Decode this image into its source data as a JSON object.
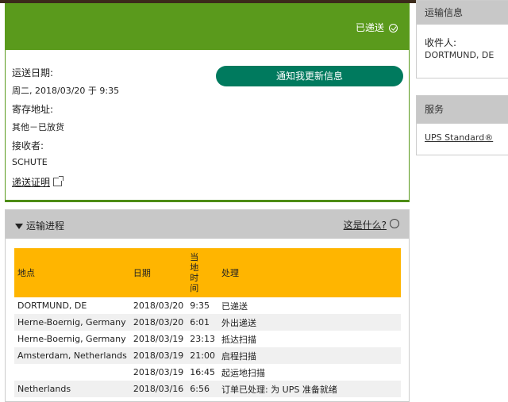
{
  "status": {
    "label": "已递送"
  },
  "delivery": {
    "date_label": "运送日期:",
    "date_value": "周二, 2018/03/20 于 9:35",
    "left_at_label": "寄存地址:",
    "left_at_value": "其他－已放货",
    "received_by_label": "接收者:",
    "received_by_value": "SCHUTE",
    "proof_link": "递送证明",
    "notify_button": "通知我更新信息"
  },
  "shipment_info": {
    "title": "运输信息",
    "recipient_label": "收件人:",
    "recipient_value": "DORTMUND, DE"
  },
  "service": {
    "title": "服务",
    "name": "UPS Standard®"
  },
  "progress": {
    "title": "运输进程",
    "whats_this": "这是什么?",
    "columns": {
      "location": "地点",
      "date": "日期",
      "local_time": "当\n地\n时\n间",
      "activity": "处理"
    },
    "rows": [
      {
        "location": "DORTMUND, DE",
        "date": "2018/03/20",
        "time": "9:35",
        "activity": "已递送"
      },
      {
        "location": "Herne-Boernig, Germany",
        "date": "2018/03/20",
        "time": "6:01",
        "activity": "外出递送"
      },
      {
        "location": "Herne-Boernig, Germany",
        "date": "2018/03/19",
        "time": "23:13",
        "activity": "抵达扫描"
      },
      {
        "location": "Amsterdam, Netherlands",
        "date": "2018/03/19",
        "time": "21:00",
        "activity": "启程扫描"
      },
      {
        "location": "",
        "date": "2018/03/19",
        "time": "16:45",
        "activity": "起运地扫描"
      },
      {
        "location": "Netherlands",
        "date": "2018/03/16",
        "time": "6:56",
        "activity": "订单已处理: 为 UPS 准备就绪"
      }
    ]
  },
  "colors": {
    "green": "#5a9a1c",
    "teal_button": "#007a5e",
    "table_header": "#ffb500"
  }
}
